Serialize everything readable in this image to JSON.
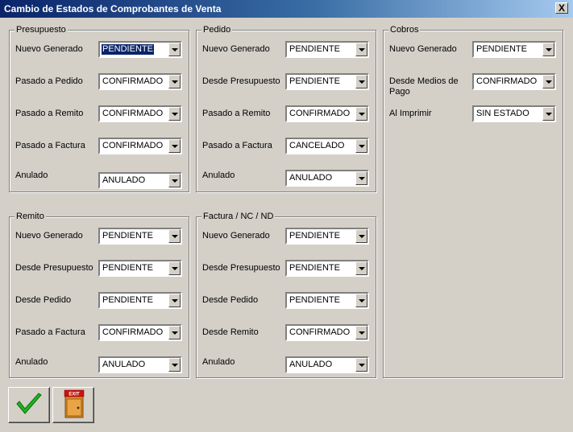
{
  "window": {
    "title": "Cambio de Estados de Comprobantes de Venta",
    "close_label": "X"
  },
  "groups": {
    "presupuesto": {
      "title": "Presupuesto",
      "rows": [
        {
          "label": "Nuevo Generado",
          "value": "PENDIENTE"
        },
        {
          "label": "Pasado a Pedido",
          "value": "CONFIRMADO"
        },
        {
          "label": "Pasado a Remito",
          "value": "CONFIRMADO"
        },
        {
          "label": "Pasado a Factura",
          "value": "CONFIRMADO"
        },
        {
          "label": "Anulado",
          "value": "ANULADO"
        }
      ]
    },
    "pedido": {
      "title": "Pedido",
      "rows": [
        {
          "label": "Nuevo Generado",
          "value": "PENDIENTE"
        },
        {
          "label": "Desde Presupuesto",
          "value": "PENDIENTE"
        },
        {
          "label": "Pasado a Remito",
          "value": "CONFIRMADO"
        },
        {
          "label": "Pasado a Factura",
          "value": "CANCELADO"
        },
        {
          "label": "Anulado",
          "value": "ANULADO"
        }
      ]
    },
    "cobros": {
      "title": "Cobros",
      "rows": [
        {
          "label": "Nuevo Generado",
          "value": "PENDIENTE"
        },
        {
          "label": "Desde Medios de",
          "label2": "Pago",
          "value": "CONFIRMADO"
        },
        {
          "label": "Al Imprimir",
          "value": "SIN ESTADO"
        }
      ]
    },
    "remito": {
      "title": "Remito",
      "rows": [
        {
          "label": "Nuevo Generado",
          "value": "PENDIENTE"
        },
        {
          "label": "Desde Presupuesto",
          "value": "PENDIENTE"
        },
        {
          "label": "Desde Pedido",
          "value": "PENDIENTE"
        },
        {
          "label": "Pasado a Factura",
          "value": "CONFIRMADO"
        },
        {
          "label": "Anulado",
          "value": "ANULADO"
        }
      ]
    },
    "factura": {
      "title": "Factura / NC / ND",
      "rows": [
        {
          "label": "Nuevo Generado",
          "value": "PENDIENTE"
        },
        {
          "label": "Desde Presupuesto",
          "value": "PENDIENTE"
        },
        {
          "label": "Desde Pedido",
          "value": "PENDIENTE"
        },
        {
          "label": "Desde Remito",
          "value": "CONFIRMADO"
        },
        {
          "label": "Anulado",
          "value": "ANULADO"
        }
      ]
    }
  },
  "buttons": {
    "exit_sign": "EXIT"
  },
  "icons": {
    "accept": "checkmark-icon",
    "exit": "exit-door-icon"
  },
  "colors": {
    "title_start": "#0a246a",
    "title_end": "#a6caf0",
    "check": "#1fb31f"
  }
}
